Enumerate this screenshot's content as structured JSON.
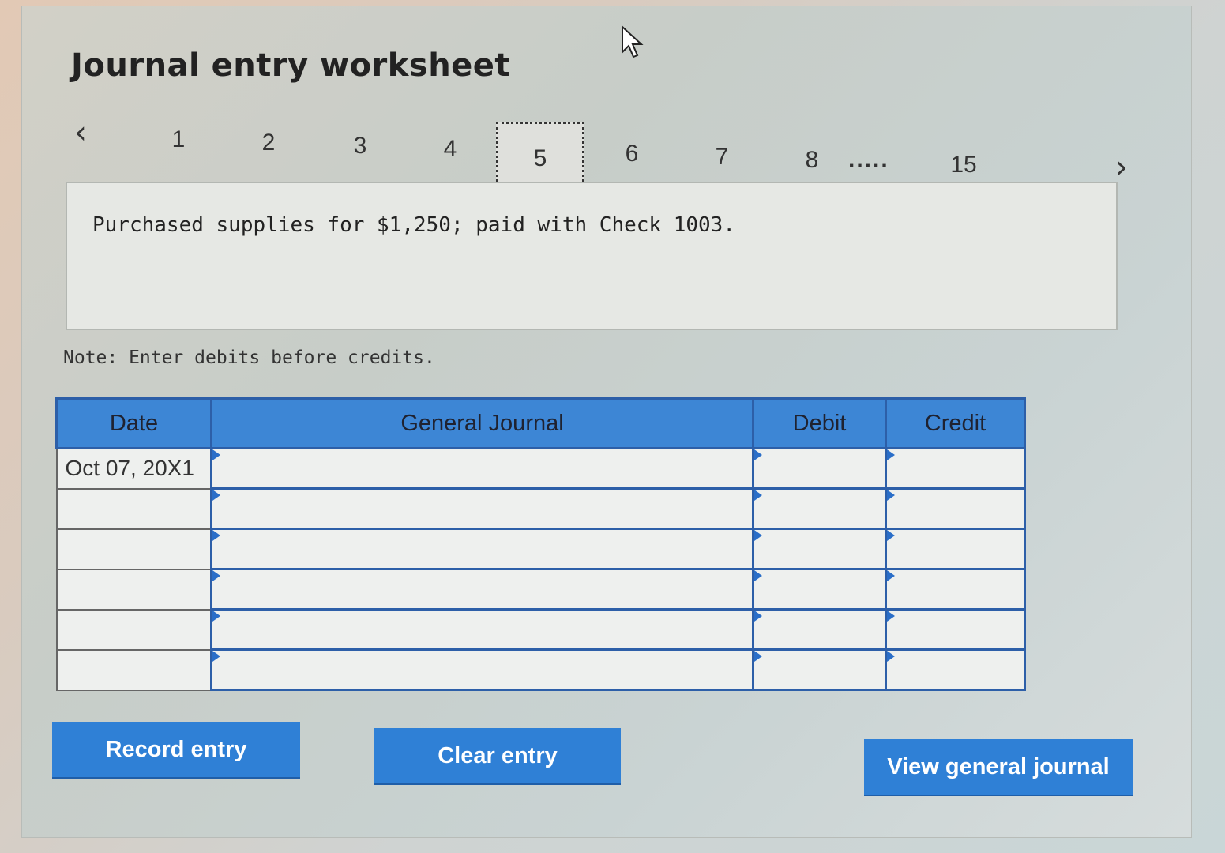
{
  "title": "Journal entry worksheet",
  "pager": {
    "prev_icon": "‹",
    "next_icon": "›",
    "pages": [
      "1",
      "2",
      "3",
      "4",
      "5",
      "6",
      "7",
      "8"
    ],
    "active": "5",
    "ellipsis": ".....",
    "last": "15"
  },
  "description": "Purchased supplies for $1,250; paid with Check 1003.",
  "note": "Note: Enter debits before credits.",
  "table": {
    "headers": {
      "date": "Date",
      "journal": "General Journal",
      "debit": "Debit",
      "credit": "Credit"
    },
    "rows": [
      {
        "date": "Oct 07, 20X1",
        "account": "",
        "debit": "",
        "credit": ""
      },
      {
        "date": "",
        "account": "",
        "debit": "",
        "credit": ""
      },
      {
        "date": "",
        "account": "",
        "debit": "",
        "credit": ""
      },
      {
        "date": "",
        "account": "",
        "debit": "",
        "credit": ""
      },
      {
        "date": "",
        "account": "",
        "debit": "",
        "credit": ""
      },
      {
        "date": "",
        "account": "",
        "debit": "",
        "credit": ""
      }
    ]
  },
  "buttons": {
    "record": "Record entry",
    "clear": "Clear entry",
    "view": "View general journal"
  },
  "colors": {
    "accent": "#2f80d6",
    "header_blue": "#3d86d5",
    "border_blue": "#2d5fa8"
  }
}
